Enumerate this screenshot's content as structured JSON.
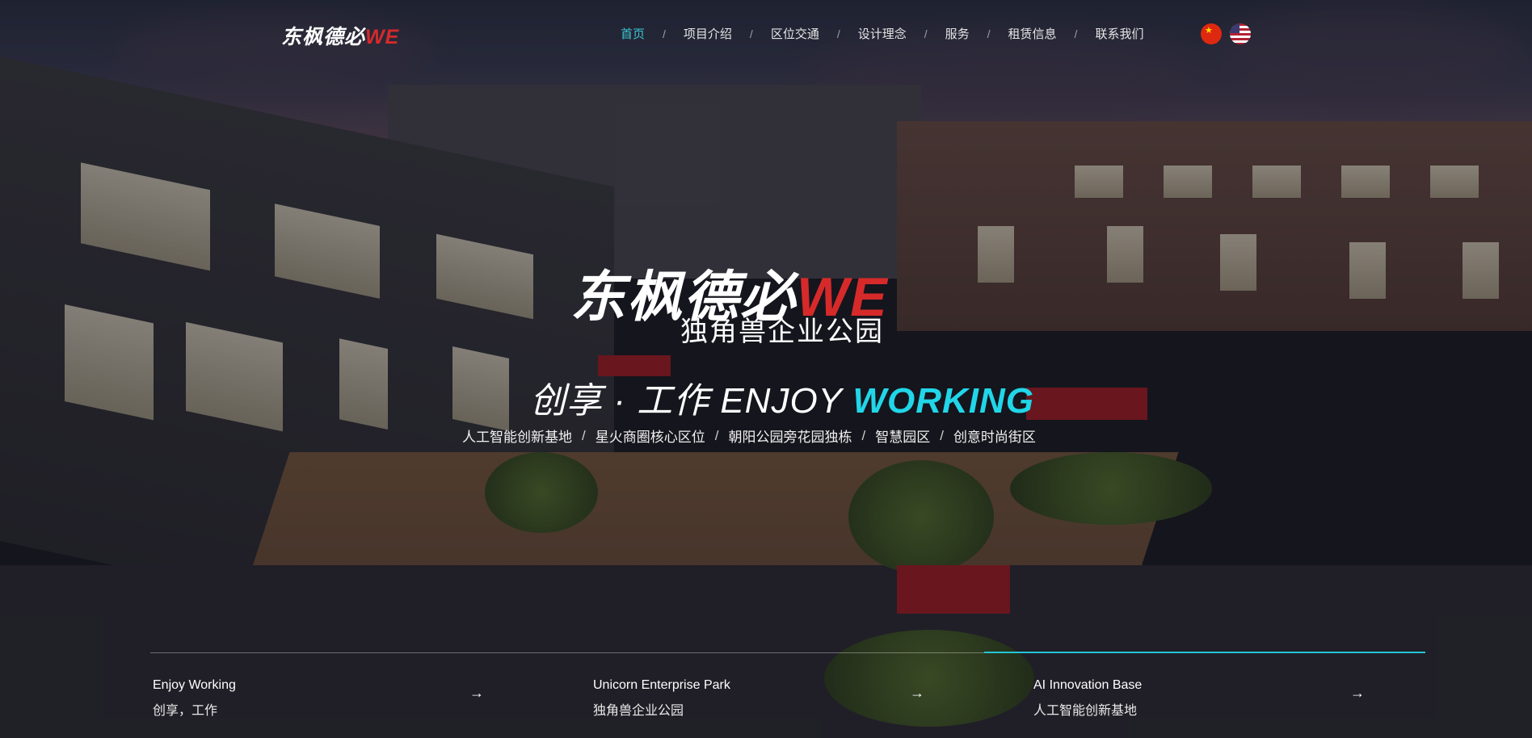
{
  "nav": {
    "logo_cn": "东枫德必",
    "logo_we": "WE",
    "menu": [
      {
        "label": "首页"
      },
      {
        "label": "项目介绍"
      },
      {
        "label": "区位交通"
      },
      {
        "label": "设计理念"
      },
      {
        "label": "服务"
      },
      {
        "label": "租赁信息"
      },
      {
        "label": "联系我们"
      }
    ],
    "separator": "/",
    "active_index": 0,
    "languages": [
      "chinese-flag-icon",
      "us-flag-icon"
    ]
  },
  "hero": {
    "title_cn": "东枫德必",
    "title_we": "WE",
    "subtitle": "独角兽企业公园",
    "tagline_cn": "创享 · 工作 ENJOY ",
    "tagline_accent": "WORKING",
    "features": [
      "人工智能创新基地",
      "星火商圈核心区位",
      "朝阳公园旁花园独栋",
      "智慧园区",
      "创意时尚街区"
    ],
    "feature_separator": "/"
  },
  "cards": [
    {
      "title": "Enjoy Working",
      "subtitle": "创享，工作"
    },
    {
      "title": "Unicorn Enterprise Park",
      "subtitle": "独角兽企业公园"
    },
    {
      "title": "AI Innovation Base",
      "subtitle": "人工智能创新基地"
    }
  ],
  "arrow_glyph": "→",
  "colors": {
    "accent": "#21d6e8",
    "brand_red": "#d62a2a",
    "nav_active": "#3cc7d6"
  }
}
